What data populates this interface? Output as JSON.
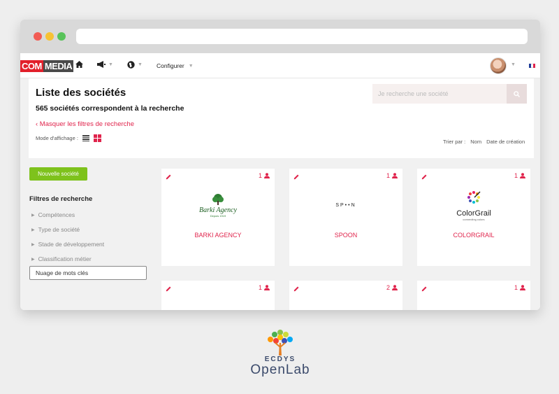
{
  "navbar": {
    "logo_com": "COM",
    "logo_media": "MEDIA",
    "configure_label": "Configurer",
    "flag_colors": [
      "#1f3d99",
      "#ffffff",
      "#e0244c"
    ]
  },
  "header": {
    "title": "Liste des sociétés",
    "subtitle": "565 sociétés correspondent à la recherche",
    "hide_filters": "‹ Masquer les filtres de recherche",
    "display_mode_label": "Mode d'affichage :",
    "search_placeholder": "Je recherche une société",
    "sort_label": "Trier par :",
    "sort_options": [
      "Nom",
      "Date de création"
    ]
  },
  "sidebar": {
    "new_button": "Nouvelle société",
    "filters_title": "Filtres de recherche",
    "filters": [
      "Compétences",
      "Type de société",
      "Stade de développement",
      "Classification métier"
    ],
    "tag_cloud_button": "Nuage de mots clés"
  },
  "cards": [
    {
      "name": "BARKI AGENCY",
      "count": "1",
      "logo_text": "Barki Agency",
      "logo_sub": "Depuis 1919"
    },
    {
      "name": "SPOON",
      "count": "1",
      "logo_text": "SP••N"
    },
    {
      "name": "COLORGRAIL",
      "count": "1",
      "logo_text": "ColorGrail",
      "logo_sub": "connecting colors"
    },
    {
      "name": "",
      "count": "1"
    },
    {
      "name": "",
      "count": "2"
    },
    {
      "name": "",
      "count": "1"
    }
  ],
  "footer_brand": {
    "line1": "ECDYS",
    "line2": "OpenLab"
  },
  "colors": {
    "accent": "#e0244c",
    "green_button": "#7ec21c"
  }
}
